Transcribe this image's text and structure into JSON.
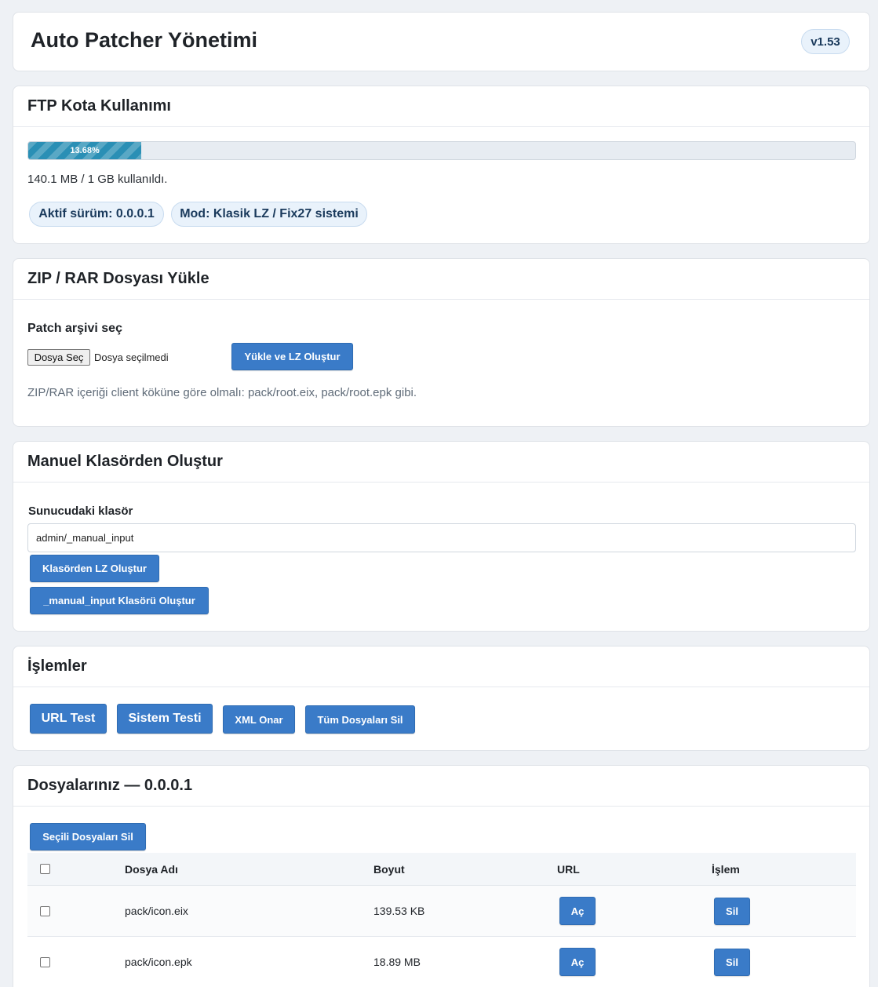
{
  "header": {
    "title": "Auto Patcher Yönetimi",
    "version": "v1.53"
  },
  "quota": {
    "title": "FTP Kota Kullanımı",
    "percent_label": "13.68%",
    "percent": 13.68,
    "usage_text": "140.1 MB / 1 GB kullanıldı.",
    "active_version": "Aktif sürüm: 0.0.0.1",
    "mode": "Mod: Klasik LZ / Fix27 sistemi"
  },
  "upload": {
    "title": "ZIP / RAR Dosyası Yükle",
    "label": "Patch arşivi seç",
    "choose_button": "Dosya Seç",
    "no_file": "Dosya seçilmedi",
    "submit": "Yükle ve LZ Oluştur",
    "hint": "ZIP/RAR içeriği client köküne göre olmalı: pack/root.eix, pack/root.epk gibi."
  },
  "manual": {
    "title": "Manuel Klasörden Oluştur",
    "label": "Sunucudaki klasör",
    "folder_value": "admin/_manual_input",
    "build_button": "Klasörden LZ Oluştur",
    "create_folder_button": "_manual_input Klasörü Oluştur"
  },
  "ops": {
    "title": "İşlemler",
    "url_test": "URL Test",
    "system_test": "Sistem Testi",
    "xml_fix": "XML Onar",
    "delete_all": "Tüm Dosyaları Sil"
  },
  "files": {
    "title": "Dosyalarınız — 0.0.0.1",
    "delete_selected": "Seçili Dosyaları Sil",
    "columns": [
      "Dosya Adı",
      "Boyut",
      "URL",
      "İşlem"
    ],
    "rows": [
      {
        "name": "pack/icon.eix",
        "size": "139.53 KB",
        "open": "Aç",
        "delete": "Sil"
      },
      {
        "name": "pack/icon.epk",
        "size": "18.89 MB",
        "open": "Aç",
        "delete": "Sil"
      }
    ]
  },
  "colors": {
    "accent": "#3a7bc8",
    "background": "#eef1f5",
    "progress": "#2a8fb5"
  }
}
